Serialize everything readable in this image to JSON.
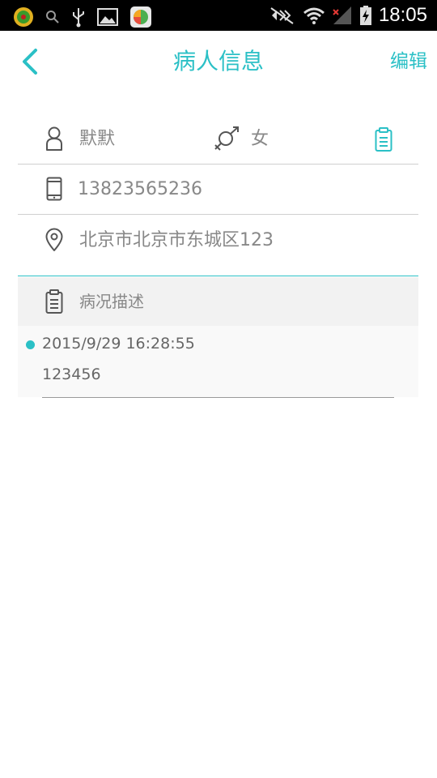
{
  "status_bar": {
    "time": "18:05",
    "icons": [
      "app-badge-icon",
      "search-icon",
      "usb-icon",
      "gallery-icon",
      "app360-icon",
      "mute-icon",
      "wifi-icon",
      "signal-icon",
      "battery-charging-icon"
    ]
  },
  "header": {
    "back_icon": "chevron-left-icon",
    "title": "病人信息",
    "edit_label": "编辑"
  },
  "patient": {
    "name": "默默",
    "gender": "女",
    "phone": "13823565236",
    "address": "北京市北京市东城区123"
  },
  "section": {
    "label": "病况描述"
  },
  "records": [
    {
      "timestamp": "2015/9/29 16:28:55",
      "text": "123456"
    }
  ],
  "colors": {
    "accent": "#2bc0c6",
    "text_gray": "#888888",
    "section_bg": "#f2f2f2"
  }
}
